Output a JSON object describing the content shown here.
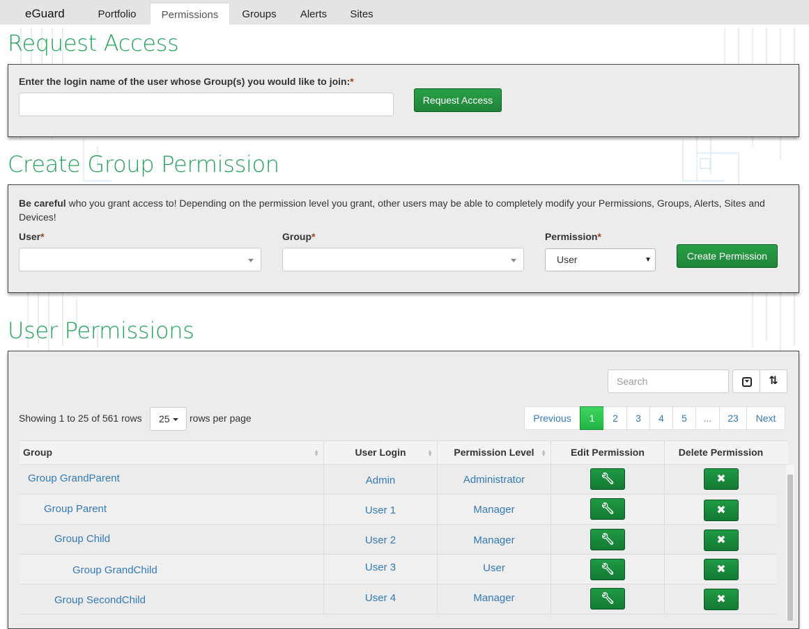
{
  "app": {
    "brand": "eGuard"
  },
  "nav": {
    "tabs": [
      "Portfolio",
      "Permissions",
      "Groups",
      "Alerts",
      "Sites"
    ],
    "active": "Permissions"
  },
  "request_access": {
    "heading": "Request Access",
    "label": "Enter the login name of the user whose Group(s) you would like to join:",
    "required_mark": "*",
    "input_value": "",
    "button": "Request Access"
  },
  "create_permission": {
    "heading": "Create Group Permission",
    "warning_bold": "Be careful",
    "warning_text": " who you grant access to! Depending on the permission level you grant, other users may be able to completely modify your Permissions, Groups, Alerts, Sites and Devices!",
    "user_label": "User",
    "group_label": "Group",
    "permission_label": "Permission",
    "required_mark": "*",
    "user_value": "",
    "group_value": "",
    "permission_value": "User",
    "button": "Create Permission"
  },
  "user_permissions": {
    "heading": "User Permissions",
    "search_placeholder": "Search",
    "showing_text": "Showing 1 to 25 of 561 rows",
    "page_size": "25",
    "rows_per_page": "rows per page",
    "pagination": {
      "previous": "Previous",
      "pages": [
        "1",
        "2",
        "3",
        "4",
        "5",
        "...",
        "23"
      ],
      "active_page": "1",
      "next": "Next"
    },
    "columns": [
      "Group",
      "User Login",
      "Permission Level",
      "Edit Permission",
      "Delete Permission"
    ],
    "rows": [
      {
        "group": "Group GrandParent",
        "user": "Admin",
        "level": "Administrator"
      },
      {
        "group": "Group  Parent",
        "user": "User 1",
        "level": "Manager"
      },
      {
        "group": "Group  Child",
        "user": "User 2",
        "level": "Manager"
      },
      {
        "group": "Group  GrandChild",
        "user": "User 3",
        "level": "User"
      },
      {
        "group": "Group  SecondChild",
        "user": "User 4",
        "level": "Manager"
      }
    ]
  },
  "colors": {
    "accent_green": "#22a35a",
    "button_green": "#1e8438",
    "link_blue": "#337ab7",
    "required_mark": "#a0420f"
  }
}
